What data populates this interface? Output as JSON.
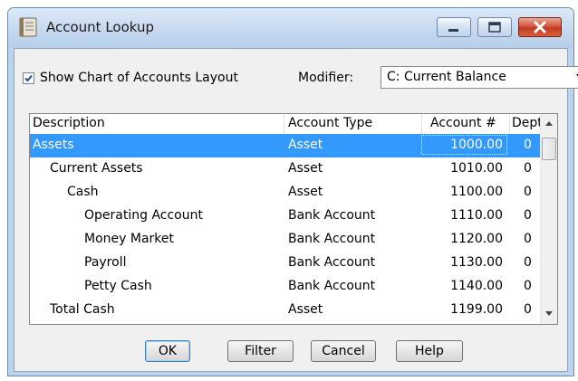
{
  "window": {
    "title": "Account Lookup",
    "icon": "ledger-icon"
  },
  "options": {
    "show_layout_label": "Show Chart of Accounts Layout",
    "show_layout_checked": true,
    "modifier_label": "Modifier:",
    "modifier_value": "C:  Current Balance"
  },
  "table": {
    "columns": [
      "Description",
      "Account Type",
      "Account #",
      "Dept"
    ],
    "rows": [
      {
        "description": "Assets",
        "type": "Asset",
        "account": "1000.00",
        "dept": "0",
        "indent": 0,
        "selected": true
      },
      {
        "description": "Current Assets",
        "type": "Asset",
        "account": "1010.00",
        "dept": "0",
        "indent": 1,
        "selected": false
      },
      {
        "description": "Cash",
        "type": "Asset",
        "account": "1100.00",
        "dept": "0",
        "indent": 2,
        "selected": false
      },
      {
        "description": "Operating Account",
        "type": "Bank Account",
        "account": "1110.00",
        "dept": "0",
        "indent": 3,
        "selected": false
      },
      {
        "description": "Money Market",
        "type": "Bank Account",
        "account": "1120.00",
        "dept": "0",
        "indent": 3,
        "selected": false
      },
      {
        "description": "Payroll",
        "type": "Bank Account",
        "account": "1130.00",
        "dept": "0",
        "indent": 3,
        "selected": false
      },
      {
        "description": "Petty Cash",
        "type": "Bank Account",
        "account": "1140.00",
        "dept": "0",
        "indent": 3,
        "selected": false
      },
      {
        "description": "Total Cash",
        "type": "Asset",
        "account": "1199.00",
        "dept": "0",
        "indent": 1,
        "selected": false
      }
    ]
  },
  "buttons": {
    "ok": "OK",
    "filter": "Filter",
    "cancel": "Cancel",
    "help": "Help"
  },
  "colors": {
    "selection": "#3399ff",
    "close_button": "#c23b23",
    "frame": "#bcd3ec"
  }
}
